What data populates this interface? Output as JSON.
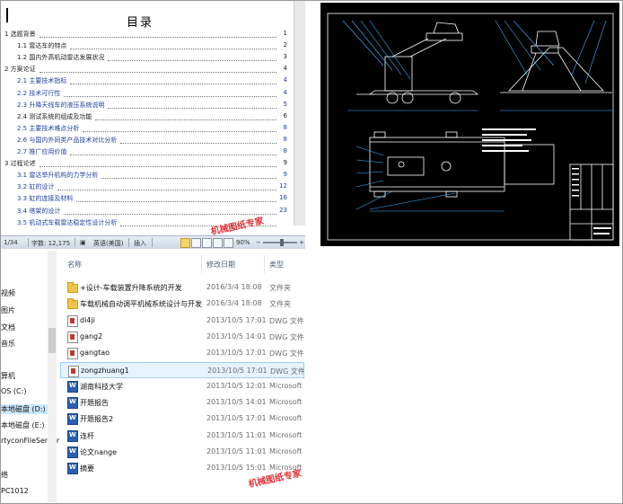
{
  "document": {
    "toc_title": "目录",
    "toc": [
      {
        "text": "1 选题背景",
        "page": "1",
        "level": 1,
        "color": "black"
      },
      {
        "text": "1.1 雷达车的特点",
        "page": "2",
        "level": 2,
        "color": "black"
      },
      {
        "text": "1.2 国内外高机动雷达发展状况",
        "page": "3",
        "level": 2,
        "color": "black"
      },
      {
        "text": "2 方案论证",
        "page": "4",
        "level": 1,
        "color": "black"
      },
      {
        "text": "2.1 主要技术指标",
        "page": "4",
        "level": 2,
        "color": "blue"
      },
      {
        "text": "2.2 技术可行性",
        "page": "4",
        "level": 2,
        "color": "blue"
      },
      {
        "text": "2.3 升降天线车的液压系统说明",
        "page": "5",
        "level": 2,
        "color": "blue"
      },
      {
        "text": "2.4 测试系统的组成及功能",
        "page": "6",
        "level": 2,
        "color": "black"
      },
      {
        "text": "2.5 主要技术难点分析",
        "page": "8",
        "level": 2,
        "color": "blue"
      },
      {
        "text": "2.6 与国内外同类产品技术对比分析",
        "page": "8",
        "level": 2,
        "color": "blue"
      },
      {
        "text": "2.7 推广应用价值",
        "page": "8",
        "level": 2,
        "color": "blue"
      },
      {
        "text": "3 过程论述",
        "page": "9",
        "level": 1,
        "color": "black"
      },
      {
        "text": "3.1 雷达举升机构的力学分析",
        "page": "9",
        "level": 2,
        "color": "blue"
      },
      {
        "text": "3.2 缸的设计",
        "page": "12",
        "level": 2,
        "color": "blue"
      },
      {
        "text": "3.3 缸的连接及材料",
        "page": "16",
        "level": 2,
        "color": "blue"
      },
      {
        "text": "3.4 塔架的设计",
        "page": "23",
        "level": 2,
        "color": "blue"
      },
      {
        "text": "3.5 机动式车载雷达稳定性设计分析",
        "page": "",
        "level": 2,
        "color": "blue"
      }
    ],
    "status": {
      "page": "1/34",
      "words": "字数: 12,175",
      "language": "英语(美国)",
      "mode": "插入",
      "zoom": "90%"
    },
    "watermark1": "机械图纸专家",
    "watermark2": "机械图纸专家"
  },
  "explorer": {
    "nav_items": [
      "视频",
      "图片",
      "文档",
      "音乐",
      "算机",
      "OS (C:)",
      "本地磁盘 (D:)",
      "本地磁盘 (E:)",
      "rtyconFileServer",
      "络",
      "PC1012"
    ],
    "selected_nav": 6,
    "columns": {
      "name": "名称",
      "date": "修改日期",
      "type": "类型"
    },
    "files": [
      {
        "name": "+设计-车载装置升降系统的开发",
        "date": "2016/3/4 18:08",
        "type": "文件夹",
        "icon": "folder-icon"
      },
      {
        "name": "车载机械自动调平机械系统设计与开发",
        "date": "2016/3/4 18:08",
        "type": "文件夹",
        "icon": "folder-icon"
      },
      {
        "name": "di4ji",
        "date": "2013/10/5 17:01",
        "type": "DWG 文件",
        "icon": "dwg-file-icon"
      },
      {
        "name": "gang2",
        "date": "2013/10/5 14:01",
        "type": "DWG 文件",
        "icon": "dwg-file-icon"
      },
      {
        "name": "gangtao",
        "date": "2013/10/5 17:01",
        "type": "DWG 文件",
        "icon": "dwg-file-icon"
      },
      {
        "name": "zongzhuang1",
        "date": "2013/10/5 17:01",
        "type": "DWG 文件",
        "icon": "dwg-file-icon"
      },
      {
        "name": "湖南科技大学",
        "date": "2013/10/5 12:01",
        "type": "Microsoft W",
        "icon": "word-doc-icon"
      },
      {
        "name": "开题报告",
        "date": "2013/10/5 14:01",
        "type": "Microsoft W",
        "icon": "word-doc-icon"
      },
      {
        "name": "开题报告2",
        "date": "2013/10/5 17:01",
        "type": "Microsoft W",
        "icon": "word-doc-icon"
      },
      {
        "name": "连杆",
        "date": "2013/10/5 11:01",
        "type": "Microsoft W",
        "icon": "word-doc-icon"
      },
      {
        "name": "论文nange",
        "date": "2013/10/5 11:01",
        "type": "Microsoft W",
        "icon": "word-doc-icon"
      },
      {
        "name": "摘要",
        "date": "2013/10/5 15:01",
        "type": "Microsoft W",
        "icon": "word-doc-icon"
      }
    ],
    "selected_file": 5
  },
  "cad": {
    "colors": {
      "background": "#000000",
      "lines": "#ffffff",
      "dimensions": "#3fb5ff"
    }
  }
}
